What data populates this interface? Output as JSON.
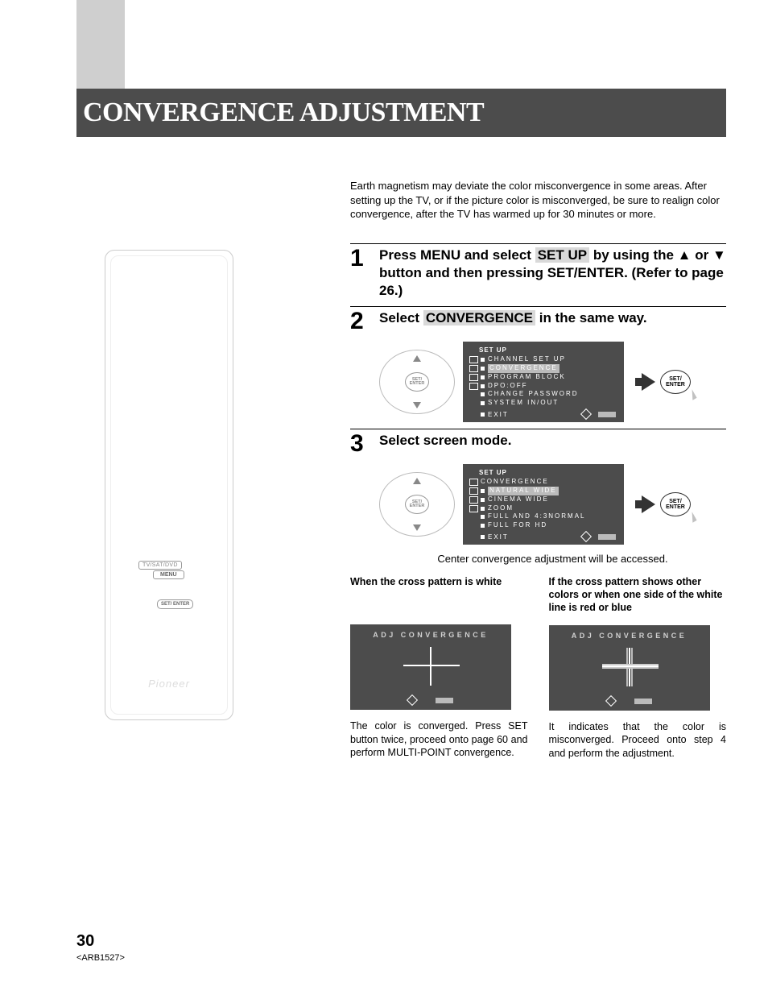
{
  "page_title": "CONVERGENCE ADJUSTMENT",
  "intro": "Earth magnetism may deviate the color misconvergence in some areas. After setting up the TV, or if the picture color is misconverged, be sure to realign color convergence, after the TV has warmed up for 30 minutes or more.",
  "remote": {
    "mode_label": "TV/SAT/DVD",
    "menu_label": "MENU",
    "set_label": "SET/\nENTER",
    "brand": "Pioneer"
  },
  "steps": {
    "s1": {
      "num": "1",
      "pre": "Press MENU and select ",
      "boxed": "SET UP",
      "mid": " by using the ",
      "post": " button and then pressing SET/ENTER. (Refer to page 26.)",
      "or": " or "
    },
    "s2": {
      "num": "2",
      "pre": "Select ",
      "boxed": "CONVERGENCE",
      "post": " in the same way.",
      "dpad_center": "SET/\nENTER",
      "press": "SET/\nENTER",
      "osd": {
        "title": "SET UP",
        "items": [
          "CHANNEL SET UP",
          "CONVERGENCE",
          "PROGRAM BLOCK",
          "DPO:OFF",
          "CHANGE PASSWORD",
          "SYSTEM IN/OUT"
        ],
        "highlight_index": 1,
        "exit": "EXIT"
      }
    },
    "s3": {
      "num": "3",
      "head": "Select screen mode.",
      "dpad_center": "SET/\nENTER",
      "press": "SET/\nENTER",
      "osd": {
        "title": "SET UP",
        "items": [
          "CONVERGENCE",
          "NATURAL WIDE",
          "CINEMA WIDE",
          "ZOOM",
          "FULL AND 4:3NORMAL",
          "FULL FOR HD"
        ],
        "highlight_index": 1,
        "exit": "EXIT"
      },
      "note": "Center convergence adjustment will be accessed."
    }
  },
  "bottom": {
    "left": {
      "head": "When the cross pattern is white",
      "box_title": "ADJ CONVERGENCE",
      "body": "The color is converged. Press SET button twice, proceed onto page 60 and perform MULTI-POINT convergence."
    },
    "right": {
      "head": "If the cross pattern shows other colors or when one side of the white line is red or blue",
      "box_title": "ADJ CONVERGENCE",
      "body": "It indicates that the color is misconverged. Proceed onto step 4 and perform the adjustment."
    }
  },
  "page_number": "30",
  "doc_code": "<ARB1527>"
}
